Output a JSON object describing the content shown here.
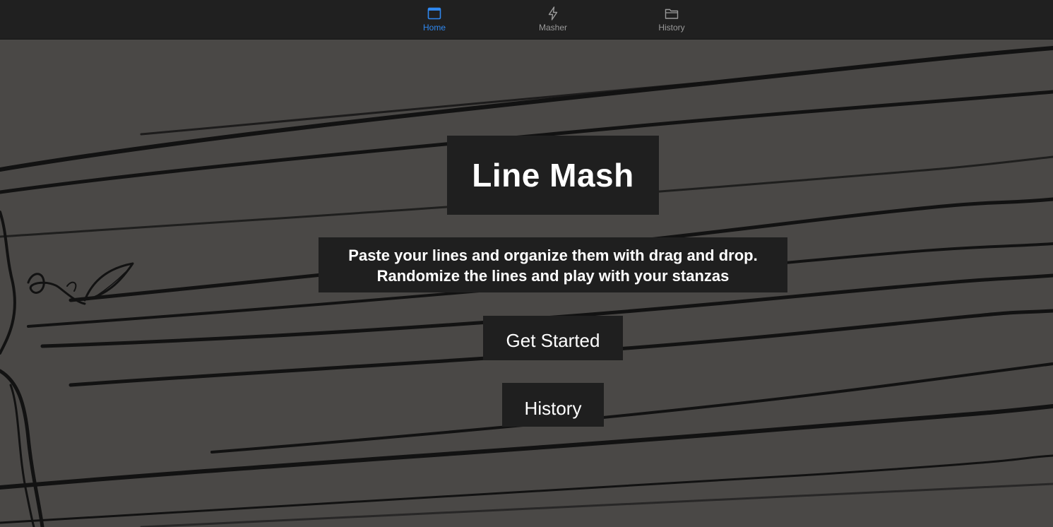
{
  "tabbar": {
    "tabs": [
      {
        "label": "Home",
        "icon": "browser-window-icon",
        "active": true
      },
      {
        "label": "Masher",
        "icon": "lightning-bolt-icon",
        "active": false
      },
      {
        "label": "History",
        "icon": "folder-icon",
        "active": false
      }
    ],
    "active_color": "#2f88f0",
    "inactive_color": "#9a9a9a",
    "background": "#202020"
  },
  "hero": {
    "title": "Line Mash",
    "subtitle_line1": "Paste your lines and organize them with drag and drop.",
    "subtitle_line2": "Randomize the lines and play with your stanzas",
    "get_started_label": "Get Started",
    "history_label": "History"
  },
  "colors": {
    "page_background": "#4a4846",
    "panel_background": "#1f1f1f",
    "sketch_ink": "#121212"
  }
}
